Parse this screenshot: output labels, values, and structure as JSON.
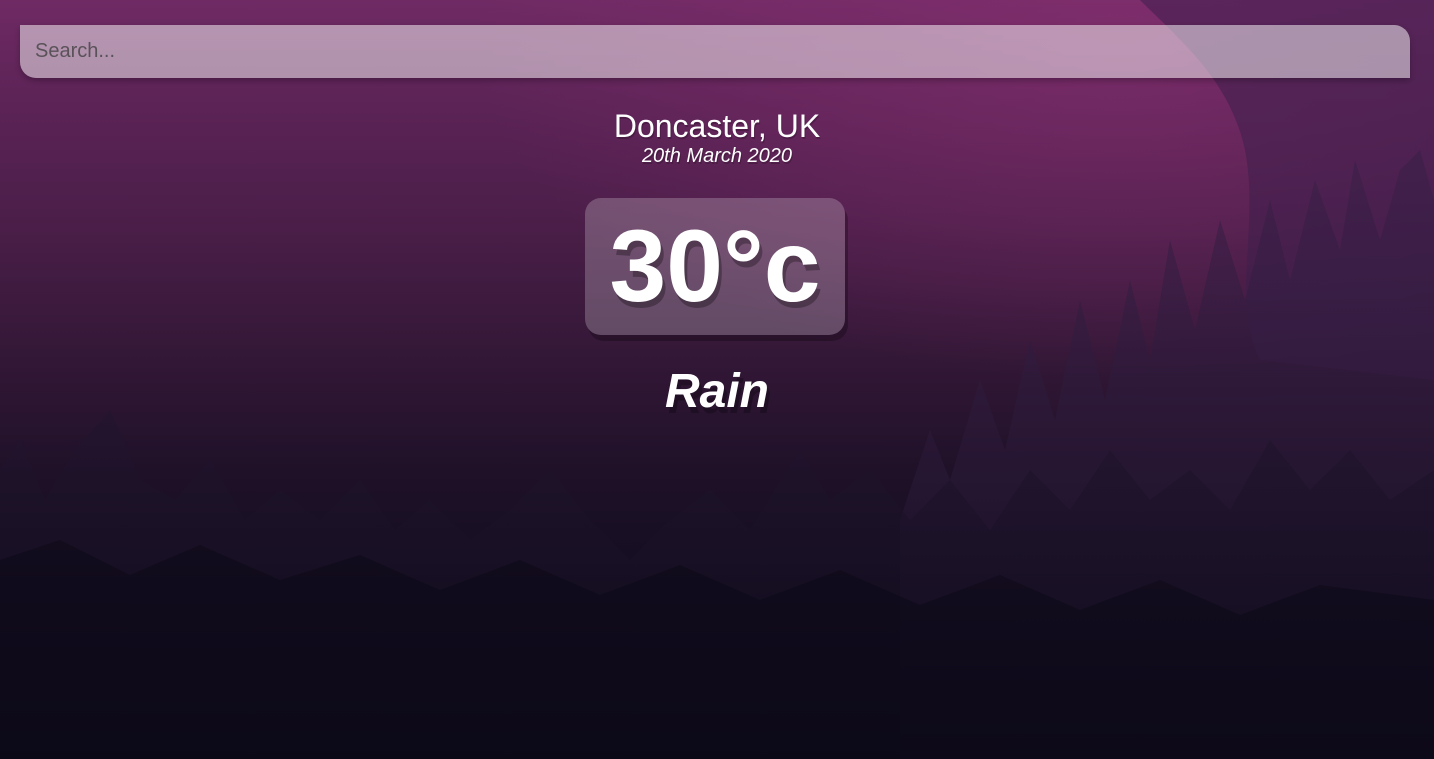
{
  "search": {
    "placeholder": "Search...",
    "value": ""
  },
  "location": {
    "name": "Doncaster, UK",
    "date": "20th March 2020"
  },
  "weather": {
    "temperature": "30°c",
    "condition": "Rain"
  },
  "colors": {
    "background_top": "#6f2a64",
    "background_bottom": "#0c0a18",
    "text": "#ffffff"
  }
}
